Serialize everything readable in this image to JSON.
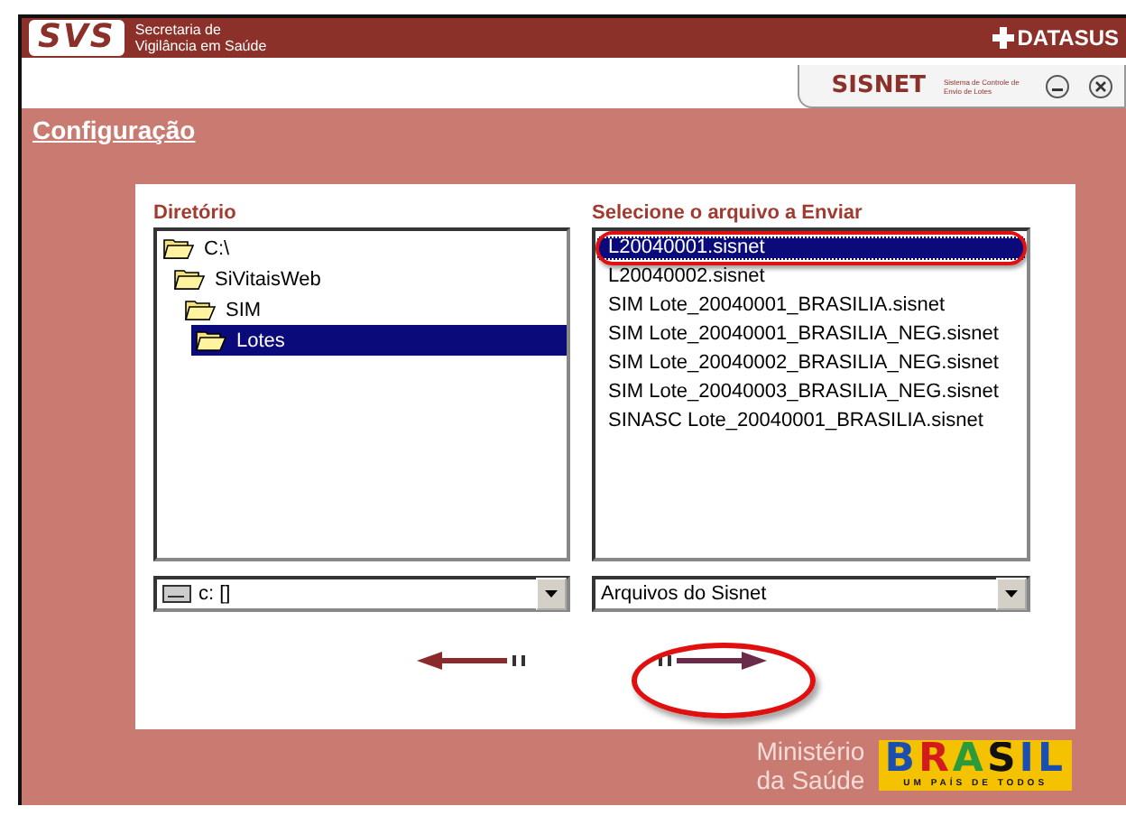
{
  "header": {
    "logo": "SVS",
    "org_line1": "Secretaria de",
    "org_line2": "Vigilância em Saúde",
    "brand": "DATASUS"
  },
  "app_tab": {
    "name": "SISNET",
    "tagline": "Sistema de Controle de Envio de Lotes"
  },
  "page_title": "Configuração",
  "directory": {
    "label": "Diretório",
    "tree": [
      {
        "label": "C:\\",
        "selected": false,
        "children": [
          {
            "label": "SiVitaisWeb",
            "selected": false,
            "children": [
              {
                "label": "SIM",
                "selected": false,
                "children": [
                  {
                    "label": "Lotes",
                    "selected": true
                  }
                ]
              }
            ]
          }
        ]
      }
    ],
    "drive": "c: []"
  },
  "files": {
    "label": "Selecione o arquivo a Enviar",
    "items": [
      {
        "label": "L20040001.sisnet",
        "selected": true
      },
      {
        "label": "L20040002.sisnet",
        "selected": false
      },
      {
        "label": "SIM Lote_20040001_BRASILIA.sisnet",
        "selected": false
      },
      {
        "label": "SIM Lote_20040001_BRASILIA_NEG.sisnet",
        "selected": false
      },
      {
        "label": "SIM Lote_20040002_BRASILIA_NEG.sisnet",
        "selected": false
      },
      {
        "label": "SIM Lote_20040003_BRASILIA_NEG.sisnet",
        "selected": false
      },
      {
        "label": "SINASC Lote_20040001_BRASILIA.sisnet",
        "selected": false
      }
    ],
    "filter": "Arquivos do Sisnet"
  },
  "footer": {
    "ministry_line1": "Ministério",
    "ministry_line2": "da Saúde",
    "logo_word": "BRASIL",
    "logo_slogan": "UM PAÍS DE TODOS"
  }
}
